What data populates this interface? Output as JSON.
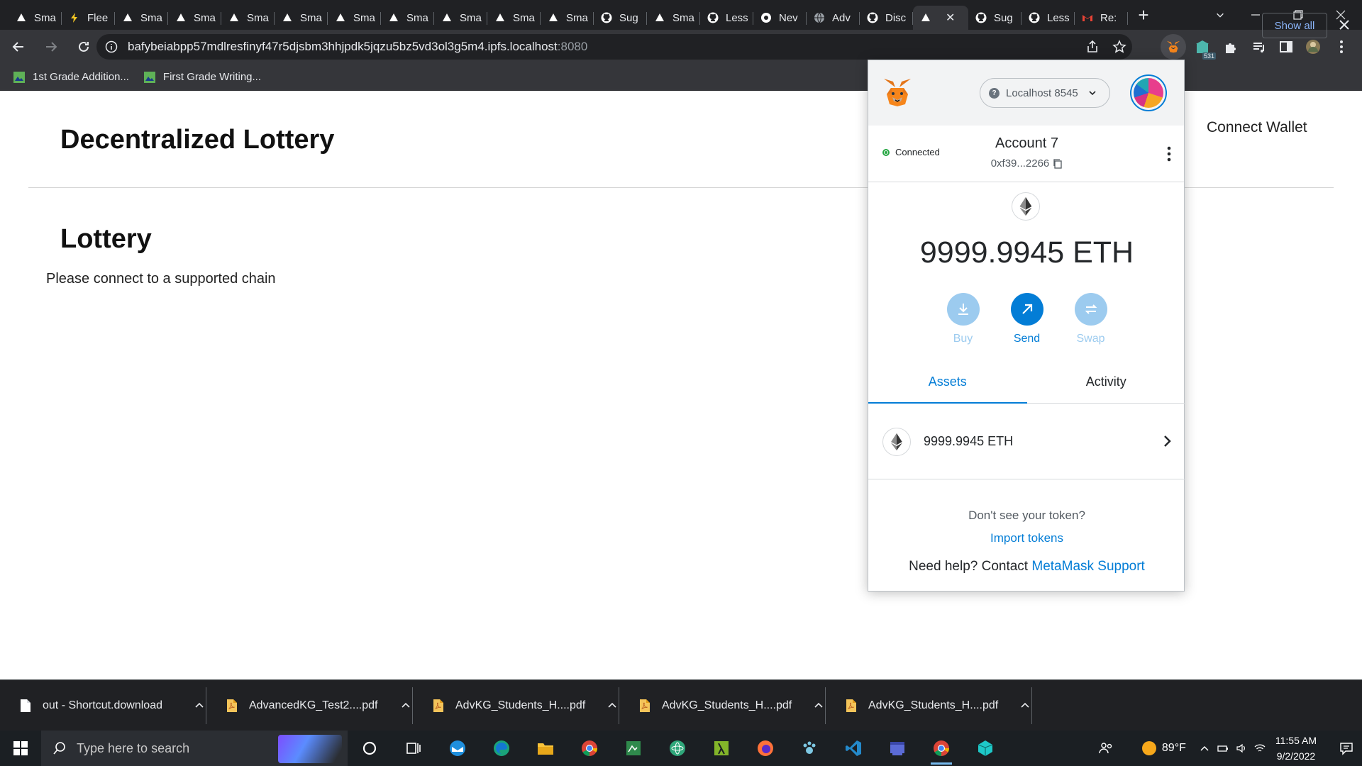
{
  "browser": {
    "tabs": [
      {
        "label": "Sma",
        "icon": "triangle-icon"
      },
      {
        "label": "Flee",
        "icon": "bolt-icon"
      },
      {
        "label": "Sma",
        "icon": "triangle-icon"
      },
      {
        "label": "Sma",
        "icon": "triangle-icon"
      },
      {
        "label": "Sma",
        "icon": "triangle-icon"
      },
      {
        "label": "Sma",
        "icon": "triangle-icon"
      },
      {
        "label": "Sma",
        "icon": "triangle-icon"
      },
      {
        "label": "Sma",
        "icon": "triangle-icon"
      },
      {
        "label": "Sma",
        "icon": "triangle-icon"
      },
      {
        "label": "Sma",
        "icon": "triangle-icon"
      },
      {
        "label": "Sma",
        "icon": "triangle-icon"
      },
      {
        "label": "Sug",
        "icon": "github-icon"
      },
      {
        "label": "Sma",
        "icon": "triangle-icon"
      },
      {
        "label": "Less",
        "icon": "github-icon"
      },
      {
        "label": "Nev",
        "icon": "chromium-icon"
      },
      {
        "label": "Adv",
        "icon": "globe-icon"
      },
      {
        "label": "Disc",
        "icon": "github-icon"
      },
      {
        "label": "",
        "icon": "triangle-icon",
        "active": true
      },
      {
        "label": "Sug",
        "icon": "github-icon"
      },
      {
        "label": "Less",
        "icon": "github-icon"
      },
      {
        "label": "Re:",
        "icon": "gmail-icon"
      }
    ],
    "url": "bafybeiabpp57mdlresfinyf47r5djsbm3hhjpdk5jqzu5bz5vd3ol3g5m4.ipfs.localhost",
    "url_port": ":8080",
    "extension_badge": "531",
    "bookmarks": [
      {
        "label": "1st Grade Addition...",
        "icon": "bookmark-image-icon"
      },
      {
        "label": "First Grade Writing...",
        "icon": "bookmark-image-icon"
      }
    ]
  },
  "page": {
    "site_title": "Decentralized Lottery",
    "connect_wallet": "Connect Wallet",
    "section_title": "Lottery",
    "notice": "Please connect to a supported chain"
  },
  "metamask": {
    "network": "Localhost 8545",
    "network_badge": "?",
    "connection_status": "Connected",
    "account_name": "Account 7",
    "account_address": "0xf39...2266",
    "balance": "9999.9945 ETH",
    "actions": [
      {
        "label": "Buy",
        "enabled": false
      },
      {
        "label": "Send",
        "enabled": true
      },
      {
        "label": "Swap",
        "enabled": false
      }
    ],
    "tabs": [
      {
        "label": "Assets",
        "active": true
      },
      {
        "label": "Activity",
        "active": false
      }
    ],
    "asset": {
      "label": "9999.9945 ETH"
    },
    "missing_token_text": "Don't see your token?",
    "import_tokens": "Import tokens",
    "help_text": "Need help? Contact ",
    "help_link": "MetaMask Support",
    "colors": {
      "accent": "#037dd6",
      "connected": "#28a745"
    }
  },
  "downloads": {
    "items": [
      {
        "name": "out - Shortcut.download",
        "icon": "file-icon"
      },
      {
        "name": "AdvancedKG_Test2....pdf",
        "icon": "pdf-file-icon"
      },
      {
        "name": "AdvKG_Students_H....pdf",
        "icon": "pdf-file-icon"
      },
      {
        "name": "AdvKG_Students_H....pdf",
        "icon": "pdf-file-icon"
      },
      {
        "name": "AdvKG_Students_H....pdf",
        "icon": "pdf-file-icon"
      }
    ],
    "show_all": "Show all"
  },
  "taskbar": {
    "search_placeholder": "Type here to search",
    "apps": [
      "cortana-icon",
      "task-view-icon",
      "thunderbird-icon",
      "edge-icon",
      "file-explorer-icon",
      "chrome-icon",
      "spreadsheet-icon",
      "atom-icon",
      "lambda-icon",
      "firefox-icon",
      "paw-icon",
      "vscode-icon",
      "window-app-icon",
      "chrome-active-icon",
      "cube-icon"
    ],
    "weather": "89°F",
    "time": "11:55 AM",
    "date": "9/2/2022"
  }
}
